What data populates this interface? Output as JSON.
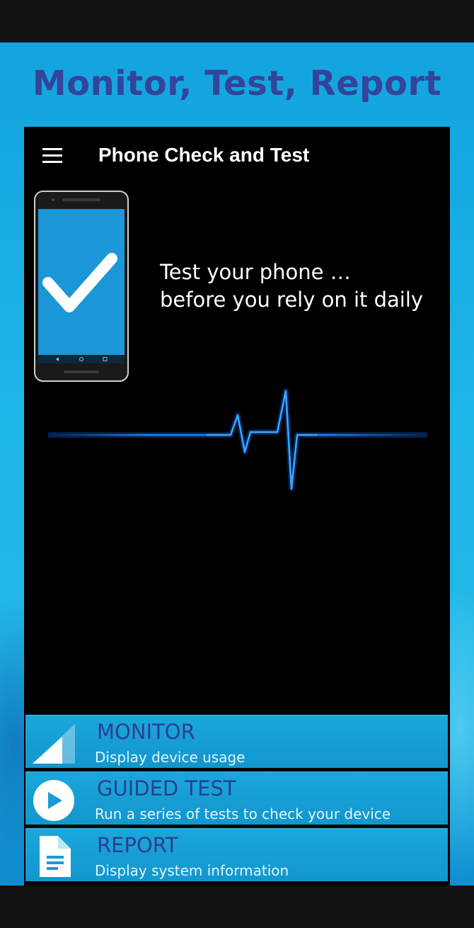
{
  "promo": {
    "headline": "Monitor, Test, Report"
  },
  "appbar": {
    "title": "Phone Check and Test",
    "menu_icon": "hamburger-menu-icon"
  },
  "hero": {
    "tagline_line1": "Test your phone …",
    "tagline_line2": "before you rely on it daily",
    "device_icon": "phone-checkmark-icon",
    "pulse_icon": "heartbeat-line-icon"
  },
  "menu": {
    "items": [
      {
        "title": "MONITOR",
        "subtitle": "Display device usage",
        "icon": "signal-strength-icon"
      },
      {
        "title": "GUIDED TEST",
        "subtitle": "Run a series of tests to check your device",
        "icon": "play-circle-icon"
      },
      {
        "title": "REPORT",
        "subtitle": "Display system information",
        "icon": "document-icon"
      }
    ]
  },
  "colors": {
    "headline": "#33449a",
    "card_background": "#1ba7dc",
    "card_title": "#2c3f8f",
    "pulse": "#1e8fff",
    "screen_background": "#000000"
  }
}
